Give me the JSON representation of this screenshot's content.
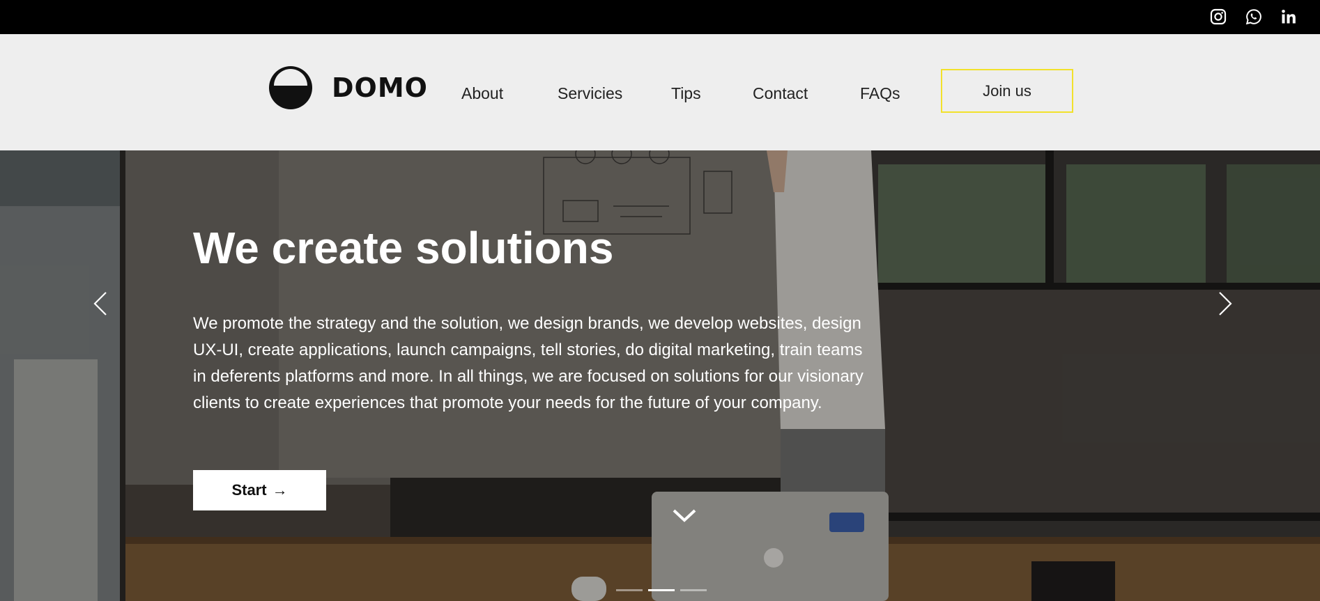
{
  "social": {
    "icons": [
      "instagram-icon",
      "whatsapp-icon",
      "linkedin-icon"
    ]
  },
  "brand": {
    "name": "DOMO"
  },
  "nav": {
    "about": "About",
    "services": "Servicies",
    "tips": "Tips",
    "contact": "Contact",
    "faqs": "FAQs",
    "join": "Join us"
  },
  "hero": {
    "title": "We create solutions",
    "text": "We promote the strategy and the solution, we design brands, we develop websites, design UX-UI, create applications, launch campaigns, tell stories, do digital marketing, train teams in deferents platforms and more. In all things, we are focused on solutions for our visionary clients to create experiences that promote your needs for the future of your company.",
    "start_label": "Start",
    "start_arrow": "→",
    "slides": 3,
    "active_slide": 2
  },
  "colors": {
    "topbar": "#000000",
    "header_bg": "#eeeeee",
    "join_border": "#f2e12b"
  }
}
